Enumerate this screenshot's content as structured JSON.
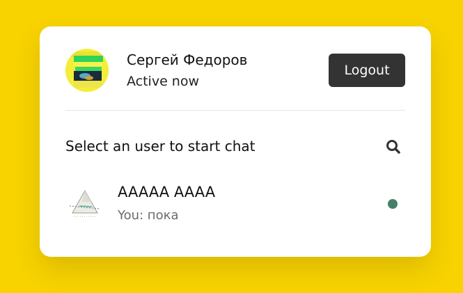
{
  "header": {
    "user_name": "Сергей Федоров",
    "user_status": "Active now",
    "logout_label": "Logout",
    "avatar_icon": "user-photo-avatar"
  },
  "search": {
    "prompt": "Select an user to start chat",
    "icon": "search-icon"
  },
  "users": [
    {
      "name": "AAAAA AAAA",
      "last_message": "You: пока",
      "status": "online",
      "avatar_icon": "triangle-logo-avatar"
    }
  ],
  "colors": {
    "background": "#f8d300",
    "card": "#ffffff",
    "logout_button": "#333333",
    "online_dot": "#468069",
    "muted_text": "#6b6b6b"
  }
}
